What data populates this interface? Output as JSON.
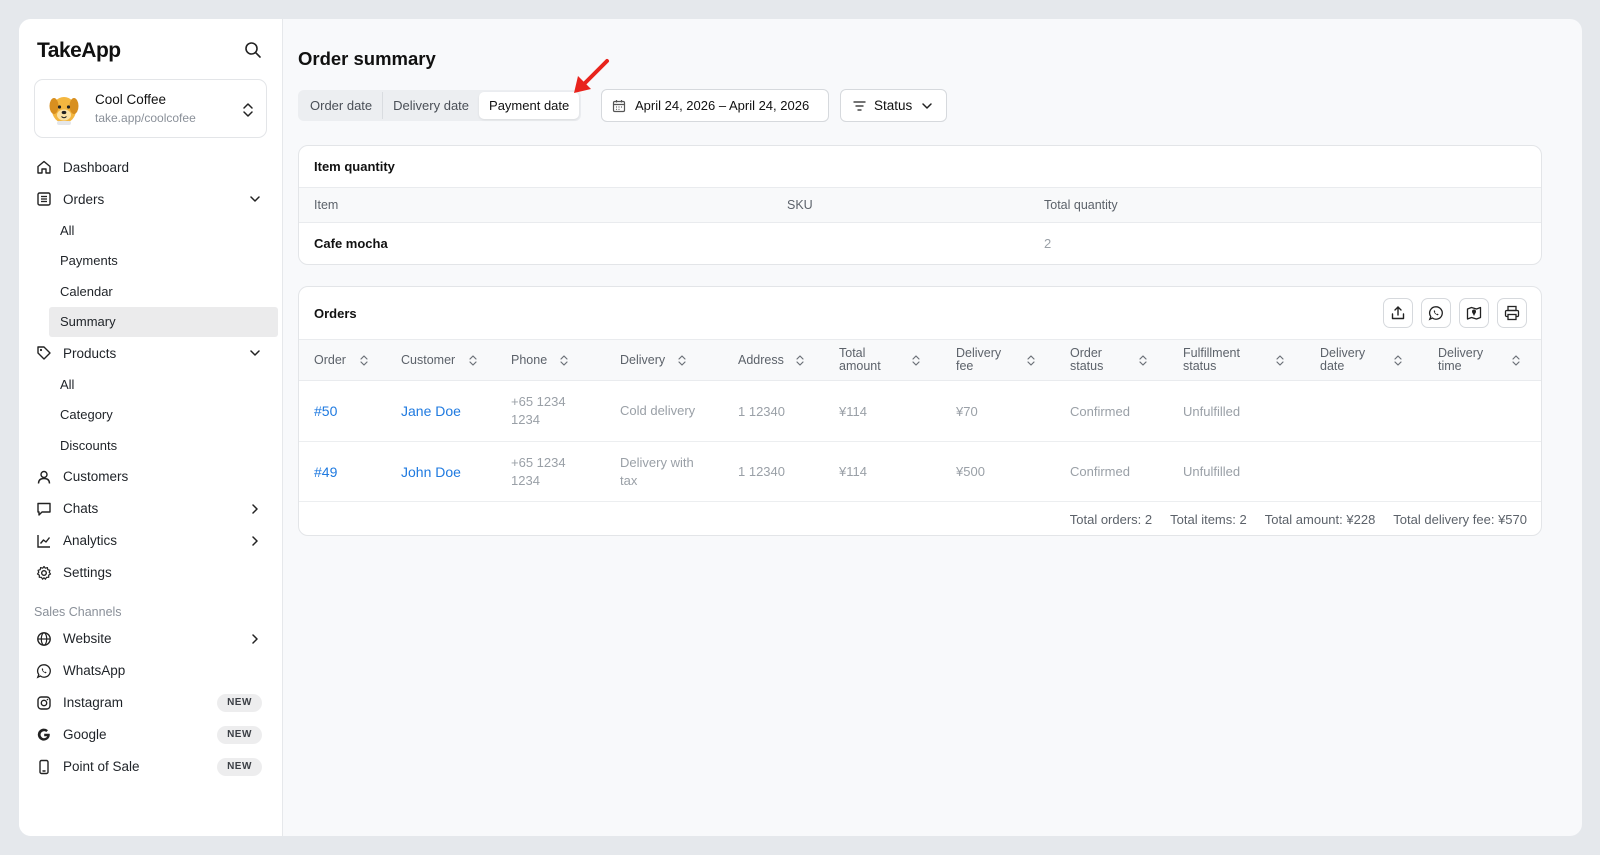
{
  "app": {
    "logo": "TakeApp"
  },
  "store": {
    "name": "Cool Coffee",
    "url": "take.app/coolcofee"
  },
  "sidebar": {
    "dashboard": "Dashboard",
    "orders": "Orders",
    "orders_sub": [
      "All",
      "Payments",
      "Calendar",
      "Summary"
    ],
    "products": "Products",
    "products_sub": [
      "All",
      "Category",
      "Discounts"
    ],
    "customers": "Customers",
    "chats": "Chats",
    "analytics": "Analytics",
    "settings": "Settings",
    "sales_channels_label": "Sales Channels",
    "website": "Website",
    "whatsapp": "WhatsApp",
    "instagram": "Instagram",
    "google": "Google",
    "pos": "Point of Sale",
    "new_badge": "NEW"
  },
  "main": {
    "title": "Order summary",
    "date_tabs": [
      "Order date",
      "Delivery date",
      "Payment date"
    ],
    "active_date_tab": "Payment date",
    "date_range": "April 24, 2026 – April 24, 2026",
    "status_filter": "Status"
  },
  "item_quantity": {
    "title": "Item quantity",
    "columns": [
      "Item",
      "SKU",
      "Total quantity"
    ],
    "rows": [
      {
        "item": "Cafe mocha",
        "sku": "",
        "qty": "2"
      }
    ]
  },
  "orders": {
    "title": "Orders",
    "columns": {
      "order": "Order",
      "customer": "Customer",
      "phone": "Phone",
      "delivery": "Delivery",
      "address": "Address",
      "total_amount": [
        "Total",
        "amount"
      ],
      "delivery_fee": [
        "Delivery",
        "fee"
      ],
      "order_status": [
        "Order",
        "status"
      ],
      "fulfillment_status": [
        "Fulfillment",
        "status"
      ],
      "delivery_date": [
        "Delivery",
        "date"
      ],
      "delivery_time": [
        "Delivery",
        "time"
      ]
    },
    "rows": [
      {
        "order": "#50",
        "customer": "Jane Doe",
        "phone": [
          "+65 1234",
          "1234"
        ],
        "delivery": [
          "Cold delivery",
          ""
        ],
        "address": "1 12340",
        "total": "¥114",
        "fee": "¥70",
        "status": "Confirmed",
        "fulfillment": "Unfulfilled",
        "date": "",
        "time": ""
      },
      {
        "order": "#49",
        "customer": "John Doe",
        "phone": [
          "+65 1234",
          "1234"
        ],
        "delivery": [
          "Delivery with",
          "tax"
        ],
        "address": "1 12340",
        "total": "¥114",
        "fee": "¥500",
        "status": "Confirmed",
        "fulfillment": "Unfulfilled",
        "date": "",
        "time": ""
      }
    ],
    "totals": {
      "orders": "Total orders: 2",
      "items": "Total items: 2",
      "amount": "Total amount: ¥228",
      "fee": "Total delivery fee: ¥570"
    }
  },
  "colors": {
    "link": "#1f7ae0",
    "annotation_arrow": "#e8231c",
    "active_nav_bg": "#ebebec"
  }
}
